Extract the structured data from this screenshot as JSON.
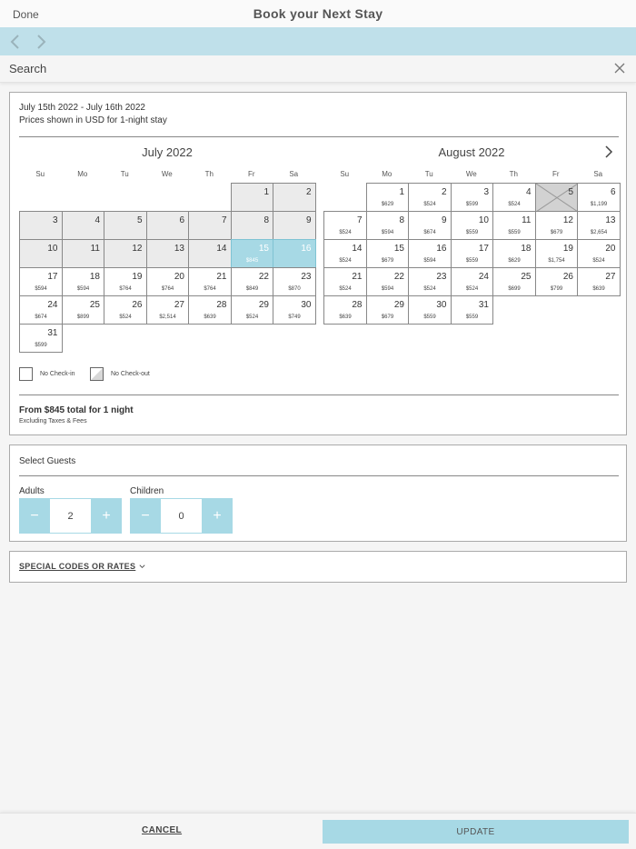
{
  "header": {
    "done_label": "Done",
    "title": "Book your Next Stay"
  },
  "nav": {
    "back_icon": "chevron-left-icon",
    "forward_icon": "chevron-right-icon"
  },
  "search": {
    "label": "Search",
    "close_icon": "close-icon"
  },
  "calendar": {
    "date_range": "July 15th 2022 - July 16th 2022",
    "prices_note": "Prices shown in USD for 1-night stay",
    "next_icon": "chevron-right-icon",
    "weekdays": [
      "Su",
      "Mo",
      "Tu",
      "We",
      "Th",
      "Fr",
      "Sa"
    ],
    "months": [
      {
        "title": "July 2022",
        "days": [
          {
            "d": "1",
            "p": "",
            "state": "past",
            "col": 5,
            "row": 0
          },
          {
            "d": "2",
            "p": "",
            "state": "past",
            "col": 6,
            "row": 0
          },
          {
            "d": "3",
            "p": "",
            "state": "past",
            "col": 0,
            "row": 1
          },
          {
            "d": "4",
            "p": "",
            "state": "past",
            "col": 1,
            "row": 1
          },
          {
            "d": "5",
            "p": "",
            "state": "past",
            "col": 2,
            "row": 1
          },
          {
            "d": "6",
            "p": "",
            "state": "past",
            "col": 3,
            "row": 1
          },
          {
            "d": "7",
            "p": "",
            "state": "past",
            "col": 4,
            "row": 1
          },
          {
            "d": "8",
            "p": "",
            "state": "past",
            "col": 5,
            "row": 1
          },
          {
            "d": "9",
            "p": "",
            "state": "past",
            "col": 6,
            "row": 1
          },
          {
            "d": "10",
            "p": "",
            "state": "past",
            "col": 0,
            "row": 2
          },
          {
            "d": "11",
            "p": "",
            "state": "past",
            "col": 1,
            "row": 2
          },
          {
            "d": "12",
            "p": "",
            "state": "past",
            "col": 2,
            "row": 2
          },
          {
            "d": "13",
            "p": "",
            "state": "past",
            "col": 3,
            "row": 2
          },
          {
            "d": "14",
            "p": "",
            "state": "past",
            "col": 4,
            "row": 2
          },
          {
            "d": "15",
            "p": "$845",
            "state": "selected",
            "col": 5,
            "row": 2
          },
          {
            "d": "16",
            "p": "",
            "state": "selected",
            "col": 6,
            "row": 2
          },
          {
            "d": "17",
            "p": "$594",
            "state": "",
            "col": 0,
            "row": 3
          },
          {
            "d": "18",
            "p": "$594",
            "state": "",
            "col": 1,
            "row": 3
          },
          {
            "d": "19",
            "p": "$764",
            "state": "",
            "col": 2,
            "row": 3
          },
          {
            "d": "20",
            "p": "$764",
            "state": "",
            "col": 3,
            "row": 3
          },
          {
            "d": "21",
            "p": "$764",
            "state": "",
            "col": 4,
            "row": 3
          },
          {
            "d": "22",
            "p": "$849",
            "state": "",
            "col": 5,
            "row": 3
          },
          {
            "d": "23",
            "p": "$870",
            "state": "",
            "col": 6,
            "row": 3
          },
          {
            "d": "24",
            "p": "$674",
            "state": "",
            "col": 0,
            "row": 4
          },
          {
            "d": "25",
            "p": "$899",
            "state": "",
            "col": 1,
            "row": 4
          },
          {
            "d": "26",
            "p": "$524",
            "state": "",
            "col": 2,
            "row": 4
          },
          {
            "d": "27",
            "p": "$2,514",
            "state": "",
            "col": 3,
            "row": 4
          },
          {
            "d": "28",
            "p": "$639",
            "state": "",
            "col": 4,
            "row": 4
          },
          {
            "d": "29",
            "p": "$524",
            "state": "",
            "col": 5,
            "row": 4
          },
          {
            "d": "30",
            "p": "$749",
            "state": "",
            "col": 6,
            "row": 4
          },
          {
            "d": "31",
            "p": "$599",
            "state": "",
            "col": 0,
            "row": 5
          }
        ]
      },
      {
        "title": "August 2022",
        "days": [
          {
            "d": "1",
            "p": "$629",
            "state": "",
            "col": 1,
            "row": 0
          },
          {
            "d": "2",
            "p": "$524",
            "state": "",
            "col": 2,
            "row": 0
          },
          {
            "d": "3",
            "p": "$599",
            "state": "",
            "col": 3,
            "row": 0
          },
          {
            "d": "4",
            "p": "$524",
            "state": "",
            "col": 4,
            "row": 0
          },
          {
            "d": "5",
            "p": "",
            "state": "unavailable",
            "col": 5,
            "row": 0
          },
          {
            "d": "6",
            "p": "$1,199",
            "state": "",
            "col": 6,
            "row": 0
          },
          {
            "d": "7",
            "p": "$524",
            "state": "",
            "col": 0,
            "row": 1
          },
          {
            "d": "8",
            "p": "$594",
            "state": "",
            "col": 1,
            "row": 1
          },
          {
            "d": "9",
            "p": "$674",
            "state": "",
            "col": 2,
            "row": 1
          },
          {
            "d": "10",
            "p": "$559",
            "state": "",
            "col": 3,
            "row": 1
          },
          {
            "d": "11",
            "p": "$559",
            "state": "",
            "col": 4,
            "row": 1
          },
          {
            "d": "12",
            "p": "$679",
            "state": "",
            "col": 5,
            "row": 1
          },
          {
            "d": "13",
            "p": "$2,654",
            "state": "",
            "col": 6,
            "row": 1
          },
          {
            "d": "14",
            "p": "$524",
            "state": "",
            "col": 0,
            "row": 2
          },
          {
            "d": "15",
            "p": "$679",
            "state": "",
            "col": 1,
            "row": 2
          },
          {
            "d": "16",
            "p": "$594",
            "state": "",
            "col": 2,
            "row": 2
          },
          {
            "d": "17",
            "p": "$559",
            "state": "",
            "col": 3,
            "row": 2
          },
          {
            "d": "18",
            "p": "$629",
            "state": "",
            "col": 4,
            "row": 2
          },
          {
            "d": "19",
            "p": "$1,754",
            "state": "",
            "col": 5,
            "row": 2
          },
          {
            "d": "20",
            "p": "$524",
            "state": "",
            "col": 6,
            "row": 2
          },
          {
            "d": "21",
            "p": "$524",
            "state": "",
            "col": 0,
            "row": 3
          },
          {
            "d": "22",
            "p": "$594",
            "state": "",
            "col": 1,
            "row": 3
          },
          {
            "d": "23",
            "p": "$524",
            "state": "",
            "col": 2,
            "row": 3
          },
          {
            "d": "24",
            "p": "$524",
            "state": "",
            "col": 3,
            "row": 3
          },
          {
            "d": "25",
            "p": "$699",
            "state": "",
            "col": 4,
            "row": 3
          },
          {
            "d": "26",
            "p": "$799",
            "state": "",
            "col": 5,
            "row": 3
          },
          {
            "d": "27",
            "p": "$639",
            "state": "",
            "col": 6,
            "row": 3
          },
          {
            "d": "28",
            "p": "$639",
            "state": "",
            "col": 0,
            "row": 4
          },
          {
            "d": "29",
            "p": "$679",
            "state": "",
            "col": 1,
            "row": 4
          },
          {
            "d": "30",
            "p": "$559",
            "state": "",
            "col": 2,
            "row": 4
          },
          {
            "d": "31",
            "p": "$559",
            "state": "",
            "col": 3,
            "row": 4
          }
        ]
      }
    ],
    "legend": {
      "no_checkin": "No Check-in",
      "no_checkout": "No Check-out"
    },
    "summary": "From $845 total for 1 night",
    "excluding": "Excluding Taxes & Fees"
  },
  "guests": {
    "title": "Select Guests",
    "adults": {
      "label": "Adults",
      "value": "2",
      "minus": "−",
      "plus": "+"
    },
    "children": {
      "label": "Children",
      "value": "0",
      "minus": "−",
      "plus": "+"
    }
  },
  "codes": {
    "label": "SPECIAL CODES OR RATES",
    "icon": "chevron-down-icon"
  },
  "footer": {
    "cancel_label": "CANCEL",
    "update_label": "UPDATE"
  },
  "colors": {
    "accent": "#a7d9e5",
    "nav_band": "#bfe0ea"
  }
}
